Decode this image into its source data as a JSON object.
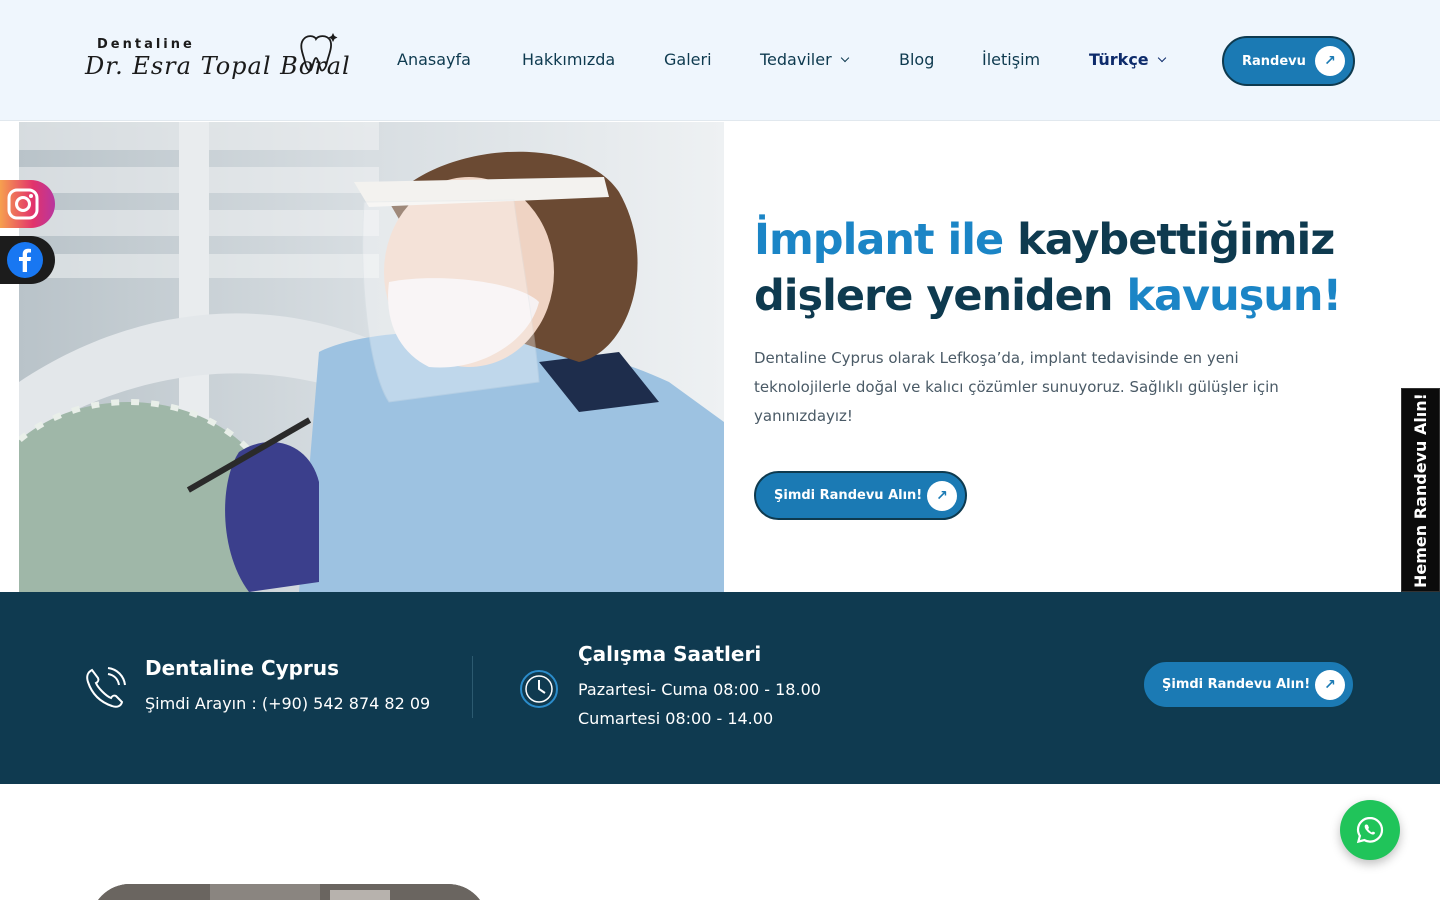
{
  "logo": {
    "brand_top": "Dentaline",
    "brand_script": "Dr. Esra Topal Boral"
  },
  "nav": {
    "items": [
      {
        "label": "Anasayfa"
      },
      {
        "label": "Hakkımızda"
      },
      {
        "label": "Galeri"
      },
      {
        "label": "Tedaviler"
      },
      {
        "label": "Blog"
      },
      {
        "label": "İletişim"
      }
    ],
    "language": "Türkçe",
    "cta": "Randevu"
  },
  "hero": {
    "title_part1": "İmplant ile",
    "title_part2": " kaybettiğimiz dişlere yeniden ",
    "title_part3": "kavuşun!",
    "text": "Dentaline Cyprus olarak Lefkoşa’da, implant tedavisinde en yeni teknolojilerle doğal ve kalıcı çözümler sunuyoruz. Sağlıklı gülüşler için yanınızdayız!",
    "cta": "Şimdi Randevu Alın!"
  },
  "side_tab": "Hemen Randevu Alın!",
  "band": {
    "contact_title": "Dentaline Cyprus",
    "contact_text": "Şimdi Arayın : (+90) 542 874 82 09",
    "hours_title": "Çalışma Saatleri",
    "hours_weekdays": "Pazartesi- Cuma 08:00 - 18.00",
    "hours_saturday": "Cumartesi 08:00 - 14.00",
    "cta": "Şimdi Randevu Alın!"
  },
  "icons": {
    "social": [
      "instagram-icon",
      "facebook-icon"
    ],
    "whatsapp": "whatsapp-icon"
  },
  "colors": {
    "primary": "#1b7ab4",
    "dark": "#0f3a50",
    "header_bg": "#eff6fd",
    "whatsapp": "#20c45a"
  }
}
